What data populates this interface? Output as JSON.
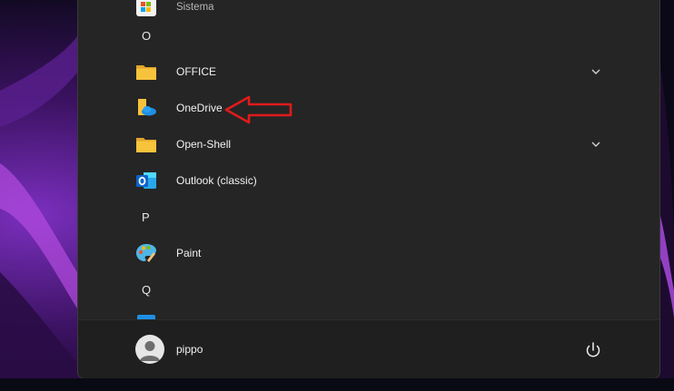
{
  "app_list": {
    "items": [
      {
        "type": "app",
        "label": "Sistema",
        "icon": "windows-tools-icon",
        "dim": true
      },
      {
        "type": "letter",
        "label": "O"
      },
      {
        "type": "folder",
        "label": "OFFICE",
        "icon": "folder-icon",
        "expandable": true
      },
      {
        "type": "app",
        "label": "OneDrive",
        "icon": "onedrive-icon"
      },
      {
        "type": "folder",
        "label": "Open-Shell",
        "icon": "folder-icon",
        "expandable": true
      },
      {
        "type": "app",
        "label": "Outlook (classic)",
        "icon": "outlook-icon"
      },
      {
        "type": "letter",
        "label": "P"
      },
      {
        "type": "app",
        "label": "Paint",
        "icon": "paint-icon"
      },
      {
        "type": "letter",
        "label": "Q"
      }
    ]
  },
  "footer": {
    "user_name": "pippo",
    "avatar_icon": "user-avatar-icon",
    "power_icon": "power-icon"
  },
  "annotation": {
    "arrow_color": "#e01b1b",
    "points_to": "OneDrive"
  },
  "colors": {
    "panel_bg": "#252525",
    "footer_bg": "#1f1f1f",
    "folder_yellow": "#f8c33c",
    "onedrive_blue": "#1e90e6",
    "outlook_blue": "#0a64c8"
  }
}
